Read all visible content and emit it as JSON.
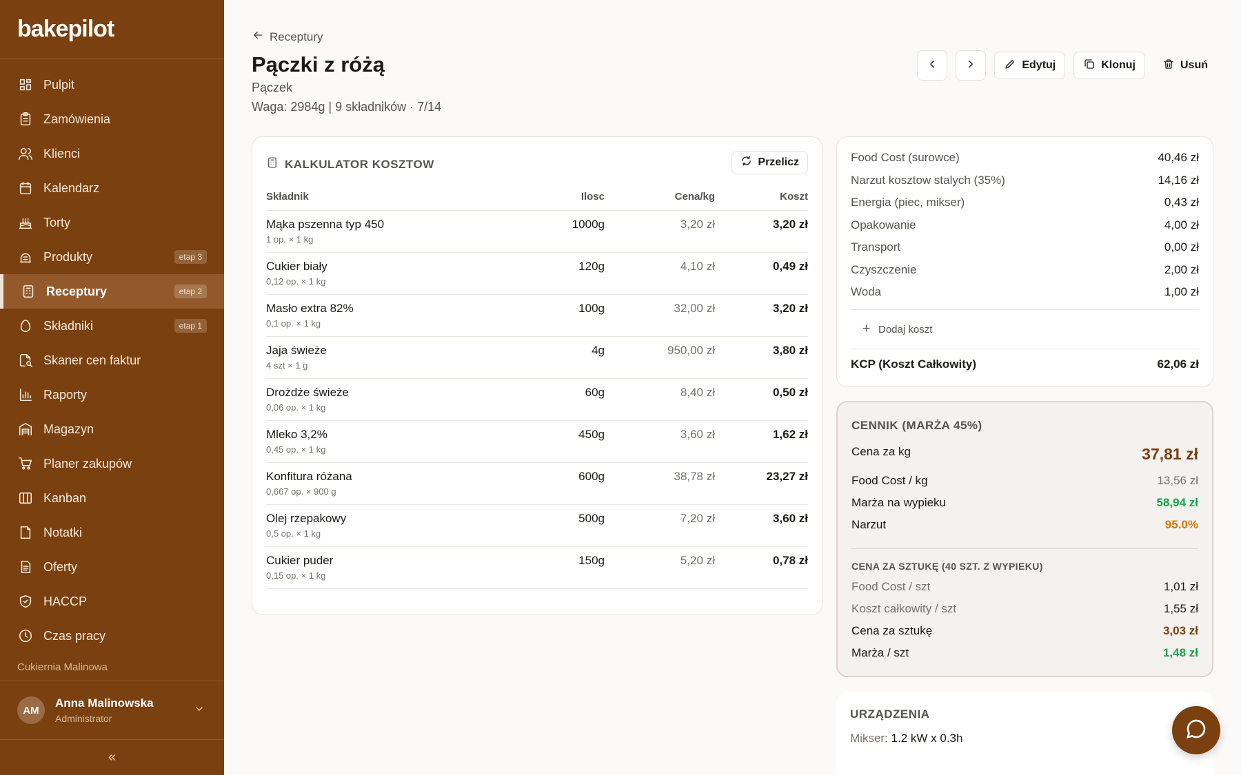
{
  "app": {
    "logo": "bakepilot"
  },
  "sidebar": {
    "items": [
      {
        "label": "Pulpit",
        "icon": "grid-icon",
        "badge": ""
      },
      {
        "label": "Zamówienia",
        "icon": "clipboard-icon",
        "badge": ""
      },
      {
        "label": "Klienci",
        "icon": "users-icon",
        "badge": ""
      },
      {
        "label": "Kalendarz",
        "icon": "calendar-icon",
        "badge": ""
      },
      {
        "label": "Torty",
        "icon": "cake-icon",
        "badge": ""
      },
      {
        "label": "Produkty",
        "icon": "product-icon",
        "badge": "etap 3"
      },
      {
        "label": "Receptury",
        "icon": "recipe-icon",
        "badge": "etap 2",
        "active": true
      },
      {
        "label": "Składniki",
        "icon": "egg-icon",
        "badge": "etap 1"
      },
      {
        "label": "Skaner cen faktur",
        "icon": "scan-icon",
        "badge": ""
      },
      {
        "label": "Raporty",
        "icon": "chart-icon",
        "badge": ""
      },
      {
        "label": "Magazyn",
        "icon": "warehouse-icon",
        "badge": ""
      },
      {
        "label": "Planer zakupów",
        "icon": "cart-icon",
        "badge": ""
      },
      {
        "label": "Kanban",
        "icon": "kanban-icon",
        "badge": ""
      },
      {
        "label": "Notatki",
        "icon": "note-icon",
        "badge": ""
      },
      {
        "label": "Oferty",
        "icon": "offer-icon",
        "badge": ""
      },
      {
        "label": "HACCP",
        "icon": "shield-icon",
        "badge": ""
      },
      {
        "label": "Czas pracy",
        "icon": "clock-icon",
        "badge": ""
      }
    ],
    "org": "Cukiernia Malinowa",
    "user": {
      "initials": "AM",
      "name": "Anna Malinowska",
      "role": "Administrator"
    },
    "collapse": "«"
  },
  "header": {
    "back": "Receptury",
    "title": "Pączki z różą",
    "subtitle": "Pączek",
    "meta": "Waga: 2984g | 9 składników · 7/14",
    "edit": "Edytuj",
    "clone": "Klonuj",
    "delete": "Usuń"
  },
  "calc": {
    "title": "KALKULATOR KOSZTOW",
    "recalc": "Przelicz",
    "columns": [
      "Składnik",
      "Ilosc",
      "Cena/kg",
      "Koszt"
    ],
    "rows": [
      {
        "name": "Mąka pszenna typ 450",
        "sub": "1 op. × 1 kg",
        "qty": "1000g",
        "price": "3,20 zł",
        "cost": "3,20 zł"
      },
      {
        "name": "Cukier biały",
        "sub": "0,12 op. × 1 kg",
        "qty": "120g",
        "price": "4,10 zł",
        "cost": "0,49 zł"
      },
      {
        "name": "Masło extra 82%",
        "sub": "0,1 op. × 1 kg",
        "qty": "100g",
        "price": "32,00 zł",
        "cost": "3,20 zł"
      },
      {
        "name": "Jaja świeże",
        "sub": "4 szt × 1 g",
        "qty": "4g",
        "price": "950,00 zł",
        "cost": "3,80 zł"
      },
      {
        "name": "Drożdże świeże",
        "sub": "0,06 op. × 1 kg",
        "qty": "60g",
        "price": "8,40 zł",
        "cost": "0,50 zł"
      },
      {
        "name": "Mleko 3,2%",
        "sub": "0,45 op. × 1 kg",
        "qty": "450g",
        "price": "3,60 zł",
        "cost": "1,62 zł"
      },
      {
        "name": "Konfitura różana",
        "sub": "0,667 op. × 900 g",
        "qty": "600g",
        "price": "38,78 zł",
        "cost": "23,27 zł"
      },
      {
        "name": "Olej rzepakowy",
        "sub": "0,5 op. × 1 kg",
        "qty": "500g",
        "price": "7,20 zł",
        "cost": "3,60 zł"
      },
      {
        "name": "Cukier puder",
        "sub": "0,15 op. × 1 kg",
        "qty": "150g",
        "price": "5,20 zł",
        "cost": "0,78 zł"
      }
    ]
  },
  "summary": {
    "rows": [
      {
        "label": "Food Cost (surowce)",
        "value": "40,46 zł"
      },
      {
        "label": "Narzut kosztow stalych (35%)",
        "value": "14,16 zł"
      },
      {
        "label": "Energia (piec, mikser)",
        "value": "0,43 zł"
      },
      {
        "label": "Opakowanie",
        "value": "4,00 zł"
      },
      {
        "label": "Transport",
        "value": "0,00 zł"
      },
      {
        "label": "Czyszczenie",
        "value": "2,00 zł"
      },
      {
        "label": "Woda",
        "value": "1,00 zł"
      }
    ],
    "add": "Dodaj koszt",
    "total_label": "KCP (Koszt Całkowity)",
    "total_value": "62,06 zł"
  },
  "pricing": {
    "title": "CENNIK (MARŻA 45%)",
    "per_kg_label": "Cena za kg",
    "per_kg_value": "37,81 zł",
    "food_cost_kg_label": "Food Cost / kg",
    "food_cost_kg_value": "13,56 zł",
    "margin_label": "Marża na wypieku",
    "margin_value": "58,94 zł",
    "markup_label": "Narzut",
    "markup_value": "95.0%",
    "piece_title": "CENA ZA SZTUKĘ (40 SZT. Z WYPIEKU)",
    "fc_piece_label": "Food Cost / szt",
    "fc_piece_value": "1,01 zł",
    "total_piece_label": "Koszt całkowity / szt",
    "total_piece_value": "1,55 zł",
    "price_piece_label": "Cena za sztukę",
    "price_piece_value": "3,03 zł",
    "margin_piece_label": "Marża / szt",
    "margin_piece_value": "1,48 zł"
  },
  "devices": {
    "title": "URZĄDZENIA",
    "line_label": "Mikser:",
    "line_value": "1.2 kW x 0.3h"
  }
}
